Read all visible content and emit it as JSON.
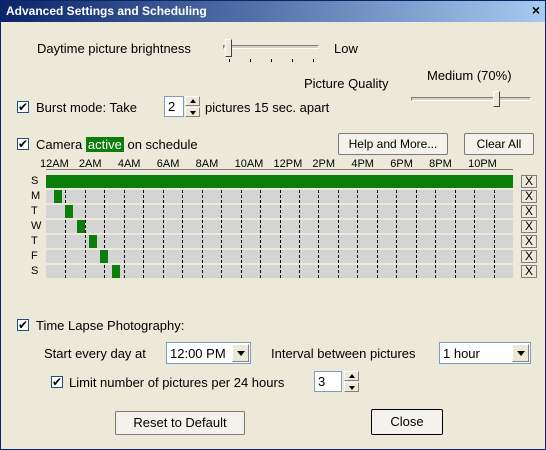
{
  "window": {
    "title": "Advanced Settings and Scheduling",
    "close_glyph": "×"
  },
  "brightness": {
    "label": "Daytime picture brightness",
    "level_text": "Low",
    "value": 0.0
  },
  "quality": {
    "label": "Picture Quality",
    "level_text": "Medium (70%)",
    "value": 0.7
  },
  "burst": {
    "checked": true,
    "label_pre": "Burst mode: Take",
    "count": "2",
    "label_post": "pictures 15 sec. apart"
  },
  "schedule": {
    "checked": true,
    "label_pre": "Camera",
    "label_active": "active",
    "label_post": "on schedule",
    "help_button": "Help and More...",
    "clear_all_button": "Clear All",
    "hours": [
      "12AM",
      "2AM",
      "4AM",
      "6AM",
      "8AM",
      "10AM",
      "12PM",
      "2PM",
      "4PM",
      "6PM",
      "8PM",
      "10PM"
    ],
    "days": [
      "S",
      "M",
      "T",
      "W",
      "T",
      "F",
      "S"
    ],
    "clear_day_glyph": "X",
    "active_ranges": [
      [
        [
          0,
          24
        ]
      ],
      [
        [
          0.4,
          0.8
        ]
      ],
      [
        [
          1.0,
          1.4
        ]
      ],
      [
        [
          1.6,
          2.0
        ]
      ],
      [
        [
          2.2,
          2.6
        ]
      ],
      [
        [
          2.8,
          3.2
        ]
      ],
      [
        [
          3.4,
          3.8
        ]
      ]
    ],
    "accent_color": "#0a7d0a"
  },
  "timelapse": {
    "checked": true,
    "label": "Time Lapse Photography:",
    "start_label": "Start every day at",
    "start_value": "12:00 PM",
    "interval_label": "Interval between pictures",
    "interval_value": "1 hour",
    "limit_checked": true,
    "limit_label": "Limit number of pictures per 24 hours",
    "limit_value": "3"
  },
  "footer": {
    "reset_button": "Reset to Default",
    "close_button": "Close"
  }
}
